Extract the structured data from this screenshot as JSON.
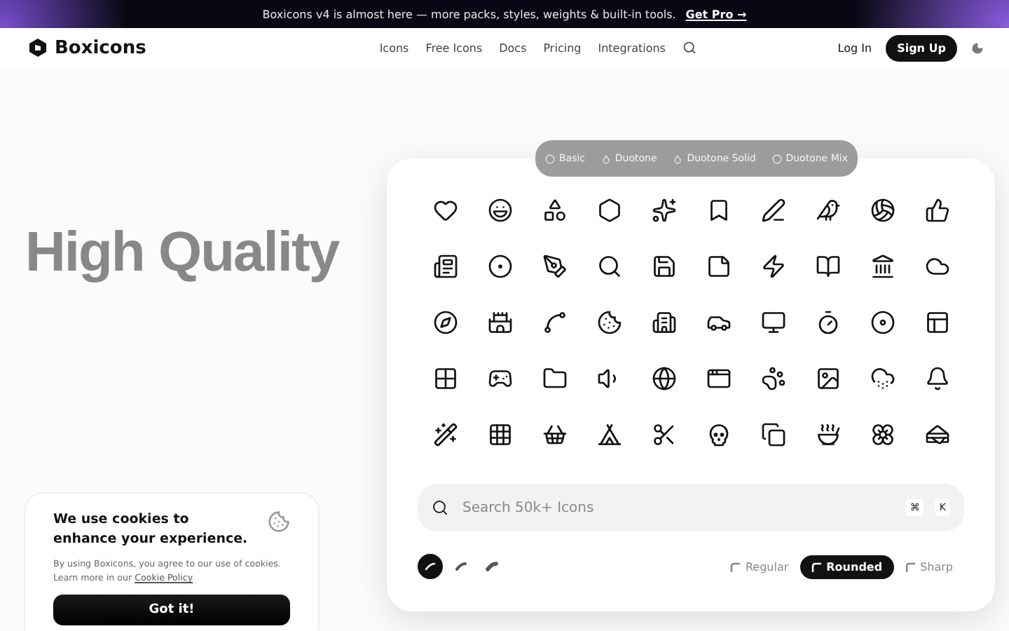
{
  "banner": {
    "text": "Boxicons v4 is almost here — more packs, styles, weights & built-in tools.",
    "link": "Get Pro →"
  },
  "nav": {
    "logo": "Boxicons",
    "links": [
      "Icons",
      "Free Icons",
      "Docs",
      "Pricing",
      "Integrations"
    ],
    "login": "Log In",
    "signup": "Sign Up"
  },
  "hero": {
    "title": "High Quality"
  },
  "style_tabs": [
    "Basic",
    "Duotone",
    "Duotone Solid",
    "Duotone Mix"
  ],
  "search": {
    "placeholder": "Search 50k+ Icons",
    "keys": [
      "⌘",
      "K"
    ]
  },
  "weights": [
    {
      "selected": true
    },
    {
      "selected": false
    },
    {
      "selected": false
    }
  ],
  "corners": [
    {
      "label": "Regular",
      "selected": false
    },
    {
      "label": "Rounded",
      "selected": true
    },
    {
      "label": "Sharp",
      "selected": false
    }
  ],
  "cookie": {
    "title": "We use cookies to enhance your experience.",
    "body": "By using Boxicons, you agree to our use of cookies. Learn more in our",
    "link": "Cookie Policy",
    "button": "Got it!"
  }
}
